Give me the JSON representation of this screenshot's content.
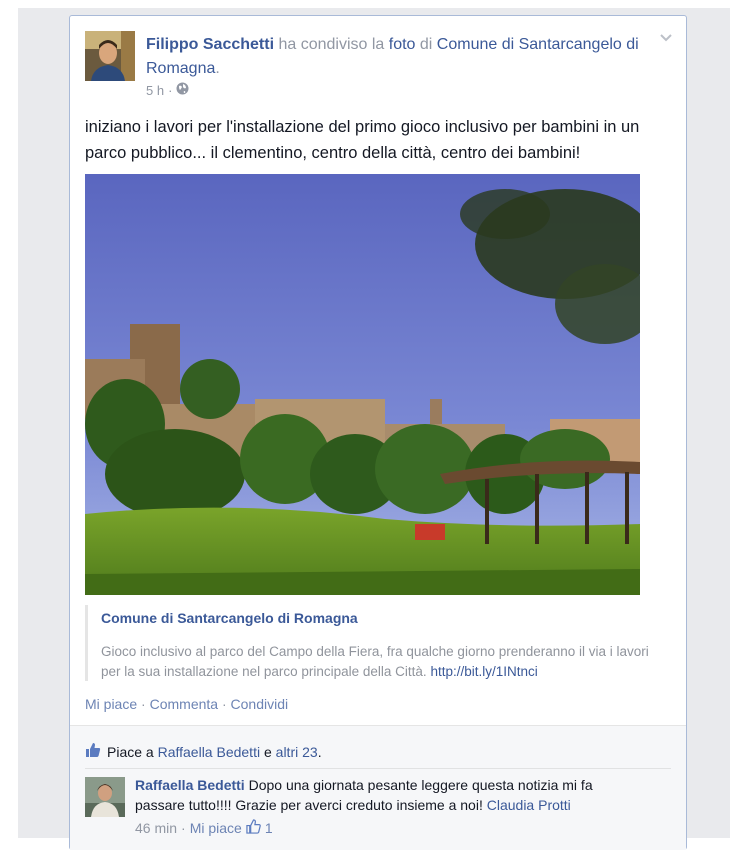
{
  "post": {
    "author": "Filippo Sacchetti",
    "shared_text": " ha condiviso la ",
    "photo_word": "foto",
    "of_text": " di ",
    "page": "Comune di Santarcangelo di Romagna",
    "period": ".",
    "time": "5 h",
    "dot": "·",
    "body": "iniziano i lavori per l'installazione del primo gioco inclusivo per bambini in un parco pubblico... il clementino, centro della città, centro dei bambini!"
  },
  "share": {
    "title": "Comune di Santarcangelo di Romagna",
    "description": "Gioco inclusivo al parco del Campo della Fiera, fra qualche giorno prenderanno il via i lavori per la sua installazione nel parco principale della Città. ",
    "link": "http://bit.ly/1INtnci"
  },
  "actions": {
    "like": "Mi piace",
    "comment": "Commenta",
    "share": "Condividi",
    "sep": " · "
  },
  "likes": {
    "prefix": "Piace a ",
    "name": "Raffaella Bedetti",
    "middle": " e ",
    "others": "altri 23",
    "suffix": "."
  },
  "comment": {
    "author": "Raffaella Bedetti",
    "text": " Dopo una giornata pesante leggere questa notizia mi fa passare tutto!!!! Grazie per averci creduto insieme a noi! ",
    "mention": "Claudia Protti",
    "time": "46 min",
    "dot": "·",
    "like": "Mi piace",
    "like_count": "1"
  },
  "colors": {
    "link": "#3b5998",
    "muted": "#9197a3",
    "text": "#141823",
    "border": "#a9bad8"
  },
  "icons": [
    "globe-icon",
    "chevron-down-icon",
    "thumbs-up-icon"
  ]
}
